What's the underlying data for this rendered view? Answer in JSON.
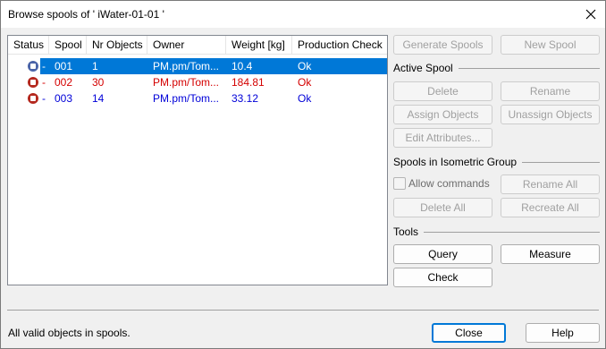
{
  "window": {
    "title": "Browse spools of ' iWater-01-01 '"
  },
  "table": {
    "columns": [
      "Status",
      "Spool",
      "Nr Objects",
      "Owner",
      "Weight [kg]",
      "Production Check"
    ],
    "rows": [
      {
        "status_icon": "spool-status-blue-icon",
        "dash": "-",
        "spool": "001",
        "nr_objects": "1",
        "owner": "PM.pm/Tom...",
        "weight": "10.4",
        "check": "Ok",
        "color": "#ffffff",
        "selected": true
      },
      {
        "status_icon": "spool-status-red-icon",
        "dash": "-",
        "spool": "002",
        "nr_objects": "30",
        "owner": "PM.pm/Tom...",
        "weight": "184.81",
        "check": "Ok",
        "color": "#d40000",
        "selected": false
      },
      {
        "status_icon": "spool-status-red-icon",
        "dash": "-",
        "spool": "003",
        "nr_objects": "14",
        "owner": "PM.pm/Tom...",
        "weight": "33.12",
        "check": "Ok",
        "color": "#0000d8",
        "selected": false
      }
    ]
  },
  "buttons": {
    "generate_spools": "Generate Spools",
    "new_spool": "New Spool",
    "delete": "Delete",
    "rename": "Rename",
    "assign_objects": "Assign Objects",
    "unassign_objects": "Unassign Objects",
    "edit_attributes": "Edit Attributes...",
    "rename_all": "Rename All",
    "delete_all": "Delete All",
    "recreate_all": "Recreate All",
    "query": "Query",
    "measure": "Measure",
    "check": "Check",
    "close": "Close",
    "help": "Help"
  },
  "groups": {
    "active_spool": "Active Spool",
    "isometric_group": "Spools in Isometric Group",
    "tools": "Tools"
  },
  "allow_commands": {
    "label": "Allow commands",
    "checked": false
  },
  "status_text": "All valid objects in spools.",
  "colors": {
    "selection": "#0078d7",
    "status_blue": "#4a64a8",
    "status_red": "#b4281e",
    "accent": "#0078d7"
  }
}
